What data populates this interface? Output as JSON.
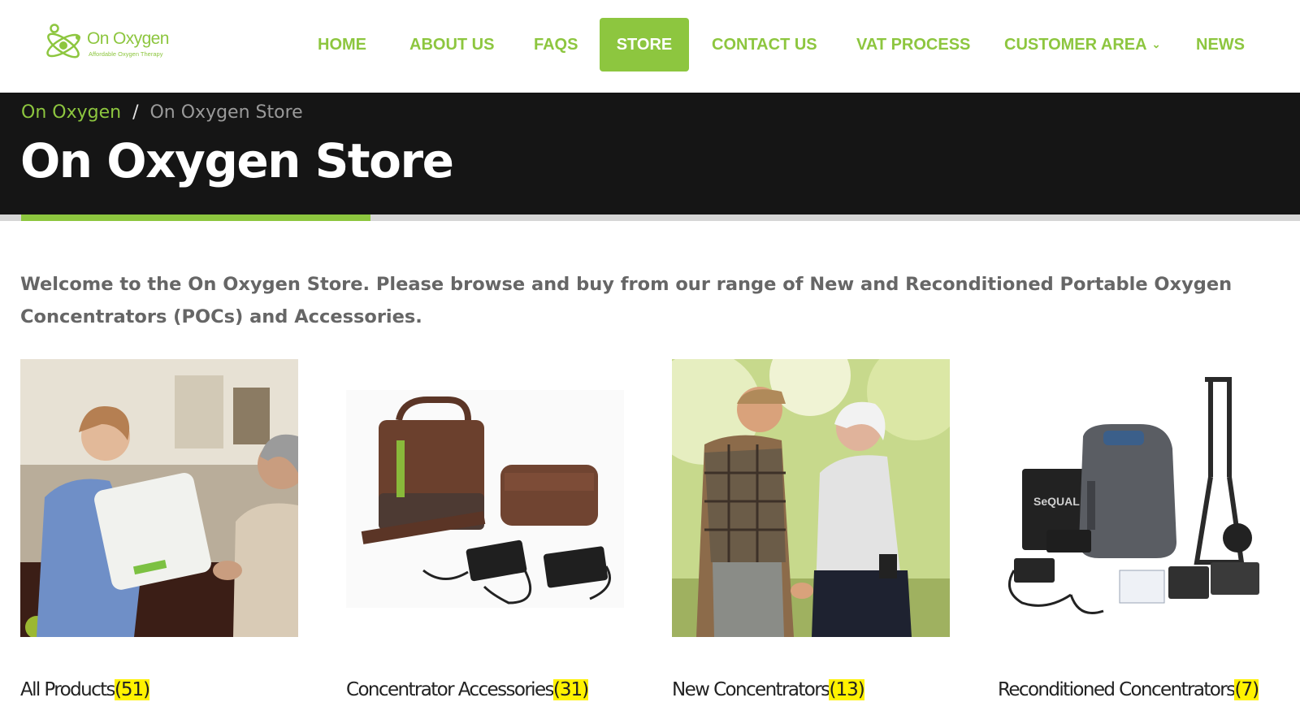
{
  "brand": {
    "name": "On Oxygen",
    "tagline": "Affordable Oxygen Therapy",
    "accent_color": "#8dc63f",
    "dark_color": "#151515",
    "highlight_color": "#fff200"
  },
  "nav": {
    "items": [
      {
        "label": "HOME"
      },
      {
        "label": "ABOUT US"
      },
      {
        "label": "FAQS"
      },
      {
        "label": "STORE",
        "active": true
      },
      {
        "label": "CONTACT US"
      },
      {
        "label": "VAT PROCESS"
      },
      {
        "label": "CUSTOMER AREA",
        "icon": "chevron-down-icon"
      },
      {
        "label": "NEWS"
      }
    ]
  },
  "breadcrumb": {
    "home": "On Oxygen",
    "separator": "/",
    "current": "On Oxygen Store"
  },
  "page": {
    "title": "On Oxygen Store",
    "intro": "Welcome to the On Oxygen Store.  Please browse and buy from our range of New and Reconditioned Portable Oxygen Concentrators (POCs) and Accessories."
  },
  "categories": [
    {
      "name": "All Products",
      "count": "(51)",
      "image": "nurse-demonstrating-concentrator-photo"
    },
    {
      "name": "Concentrator Accessories",
      "count": "(31)",
      "image": "carry-bags-and-chargers-photo"
    },
    {
      "name": "New Concentrators",
      "count": "(13)",
      "image": "senior-couple-outdoors-photo"
    },
    {
      "name": "Reconditioned Concentrators",
      "count": "(7)",
      "image": "sequal-concentrator-with-cart-photo"
    }
  ]
}
